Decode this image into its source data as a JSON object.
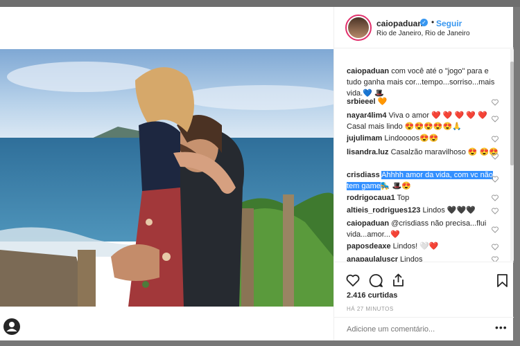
{
  "post": {
    "username": "caiopaduan",
    "follow_label": "Seguir",
    "dot": "•",
    "location": "Rio de Janeiro, Rio de Janeiro"
  },
  "comments": [
    {
      "user": "caiopaduan",
      "text": "com você até o \"jogo\" para e tudo ganha mais cor...tempo...sorriso...mais vida.💙 🎩"
    },
    {
      "user": "srbieeel",
      "text": "🧡"
    },
    {
      "user": "nayar4lim4",
      "text": "Viva o amor ❤️ ❤️ ❤️ ❤️ ❤️ Casal mais lindo 😍😍😍😍😍🙏"
    },
    {
      "user": "jujulimam",
      "text": "Lindoooos😍😍"
    },
    {
      "user": "lisandra.luz",
      "text": "Casalzão maravilhoso 😍 😍😍"
    },
    {
      "user": "crisdiass",
      "text_highlight": "Ahhhh amor da vida, com vc não tem game",
      "text_after": "🛼 🎩😍"
    },
    {
      "user": "rodrigocaua1",
      "text": "Top"
    },
    {
      "user": "altieis_rodrigues123",
      "text": "Lindos 🖤🖤🖤"
    },
    {
      "user": "caiopaduan",
      "text": "@crisdiass não precisa...flui vida...amor...❤️"
    },
    {
      "user": "paposdeaxe",
      "text": "Lindos! 🤍❤️"
    },
    {
      "user": "anapaulaluscr",
      "text": "Lindos"
    }
  ],
  "likes": "2.416 curtidas",
  "time": "HÁ 27 MINUTOS",
  "add_comment_placeholder": "Adicione um comentário...",
  "more_label": "•••",
  "colors": {
    "accent": "#3897f0",
    "highlight": "#3390ff",
    "border": "#efefef"
  }
}
